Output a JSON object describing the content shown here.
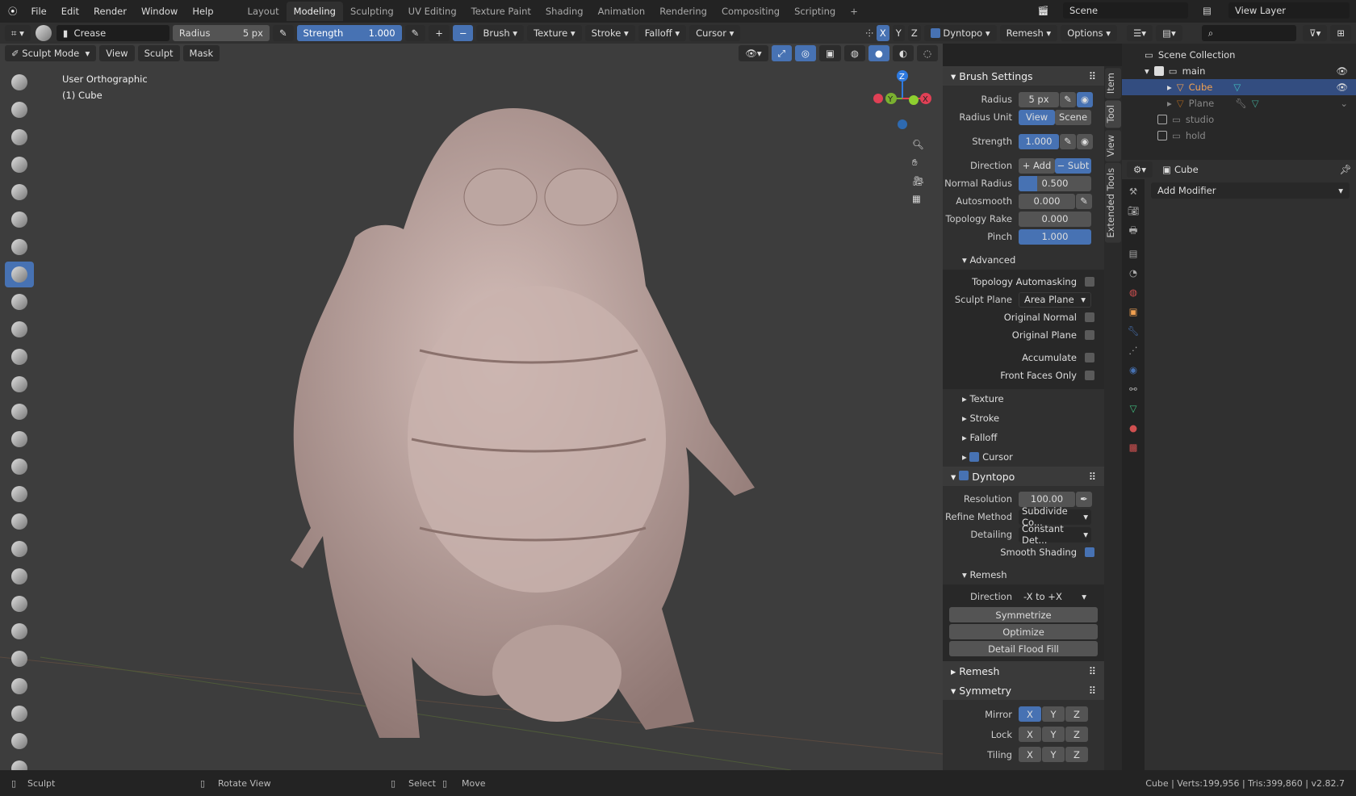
{
  "menu": [
    "File",
    "Edit",
    "Render",
    "Window",
    "Help"
  ],
  "workspaces": [
    "Layout",
    "Modeling",
    "Sculpting",
    "UV Editing",
    "Texture Paint",
    "Shading",
    "Animation",
    "Rendering",
    "Compositing",
    "Scripting"
  ],
  "active_workspace": "Modeling",
  "scene": "Scene",
  "view_layer": "View Layer",
  "header": {
    "brush": "Crease",
    "radius_label": "Radius",
    "radius": "5 px",
    "strength_label": "Strength",
    "strength": "1.000",
    "add": "+",
    "sub": "−",
    "menus": [
      "Brush",
      "Texture",
      "Stroke",
      "Falloff",
      "Cursor"
    ],
    "axes": [
      "X",
      "Y",
      "Z"
    ],
    "dyntopo": "Dyntopo",
    "remesh": "Remesh",
    "options": "Options"
  },
  "mode": {
    "label": "Sculpt Mode",
    "menus": [
      "View",
      "Sculpt",
      "Mask"
    ]
  },
  "viewport": {
    "view_name": "User Orthographic",
    "object": "(1) Cube",
    "gizmo": {
      "z": "Z",
      "y": "Y",
      "x": "X"
    }
  },
  "npanel": {
    "tabs": [
      "Item",
      "Tool",
      "View",
      "Extended Tools"
    ],
    "brush_settings": "Brush Settings",
    "radius_label": "Radius",
    "radius": "5 px",
    "radius_unit_label": "Radius Unit",
    "unit_view": "View",
    "unit_scene": "Scene",
    "strength_label": "Strength",
    "strength": "1.000",
    "direction_label": "Direction",
    "dir_add": "+ Add",
    "dir_subt": "− Subt",
    "normal_radius_label": "Normal Radius",
    "normal_radius": "0.500",
    "normal_radius_fraction": 0.25,
    "autosmooth_label": "Autosmooth",
    "autosmooth": "0.000",
    "topology_rake_label": "Topology Rake",
    "topology_rake": "0.000",
    "pinch_label": "Pinch",
    "pinch": "1.000",
    "advanced": "Advanced",
    "topology_automasking": "Topology Automasking",
    "sculpt_plane_label": "Sculpt Plane",
    "sculpt_plane": "Area Plane",
    "original_normal": "Original Normal",
    "original_plane": "Original Plane",
    "accumulate": "Accumulate",
    "front_faces": "Front Faces Only",
    "texture": "Texture",
    "stroke": "Stroke",
    "falloff": "Falloff",
    "cursor": "Cursor",
    "dyntopo": "Dyntopo",
    "resolution_label": "Resolution",
    "resolution": "100.00",
    "refine_label": "Refine Method",
    "refine": "Subdivide Co...",
    "detailing_label": "Detailing",
    "detailing": "Constant Det...",
    "smooth_shading": "Smooth Shading",
    "remesh_sub": "Remesh",
    "direction2_label": "Direction",
    "direction2": "-X to +X",
    "symmetrize": "Symmetrize",
    "optimize": "Optimize",
    "detail_flood": "Detail Flood Fill",
    "remesh": "Remesh",
    "symmetry": "Symmetry",
    "mirror_label": "Mirror",
    "lock_label": "Lock",
    "tiling_label": "Tiling",
    "xyz": [
      "X",
      "Y",
      "Z"
    ]
  },
  "outliner": {
    "root": "Scene Collection",
    "items": [
      "main",
      "Cube",
      "Plane",
      "studio",
      "hold"
    ]
  },
  "properties": {
    "object": "Cube",
    "add_modifier": "Add Modifier"
  },
  "status": {
    "sculpt": "Sculpt",
    "rotate": "Rotate View",
    "select": "Select",
    "move": "Move",
    "stats": "Cube | Verts:199,956 | Tris:399,860 | v2.82.7"
  },
  "colors": {
    "accent": "#4772b3",
    "active_object": "#f0a050",
    "mesh": "#c9b0ac"
  }
}
